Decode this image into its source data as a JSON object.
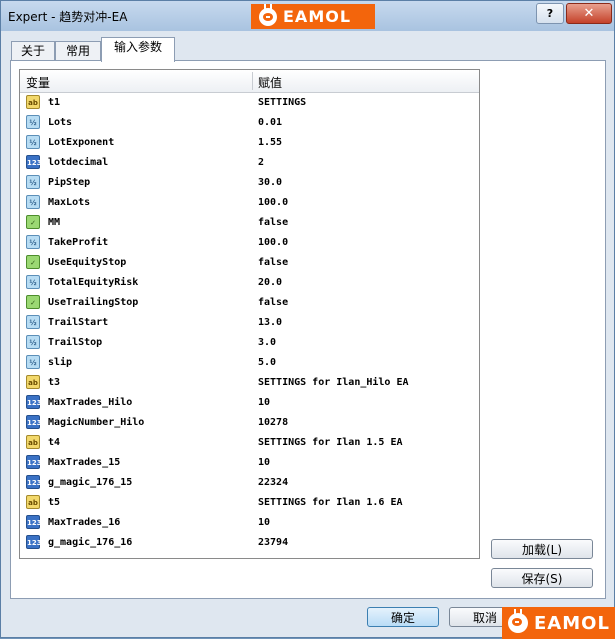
{
  "window": {
    "title": "Expert - 趋势对冲-EA",
    "help_label": "?",
    "close_label": "✕"
  },
  "logo": {
    "text": "EAMOL"
  },
  "tabs": [
    {
      "label": "关于"
    },
    {
      "label": "常用"
    },
    {
      "label": "输入参数"
    }
  ],
  "grid": {
    "headers": {
      "variable": "变量",
      "value": "赋值"
    },
    "rows": [
      {
        "type": "ab",
        "name": "t1",
        "value": "SETTINGS"
      },
      {
        "type": "v2",
        "name": "Lots",
        "value": "0.01"
      },
      {
        "type": "v2",
        "name": "LotExponent",
        "value": "1.55"
      },
      {
        "type": "i123",
        "name": "lotdecimal",
        "value": "2"
      },
      {
        "type": "v2",
        "name": "PipStep",
        "value": "30.0"
      },
      {
        "type": "v2",
        "name": "MaxLots",
        "value": "100.0"
      },
      {
        "type": "bool",
        "name": "MM",
        "value": "false"
      },
      {
        "type": "v2",
        "name": "TakeProfit",
        "value": "100.0"
      },
      {
        "type": "bool",
        "name": "UseEquityStop",
        "value": "false"
      },
      {
        "type": "v2",
        "name": "TotalEquityRisk",
        "value": "20.0"
      },
      {
        "type": "bool",
        "name": "UseTrailingStop",
        "value": "false"
      },
      {
        "type": "v2",
        "name": "TrailStart",
        "value": "13.0"
      },
      {
        "type": "v2",
        "name": "TrailStop",
        "value": "3.0"
      },
      {
        "type": "v2",
        "name": "slip",
        "value": "5.0"
      },
      {
        "type": "ab",
        "name": "t3",
        "value": "SETTINGS for Ilan_Hilo EA"
      },
      {
        "type": "i123",
        "name": "MaxTrades_Hilo",
        "value": "10"
      },
      {
        "type": "i123",
        "name": "MagicNumber_Hilo",
        "value": "10278"
      },
      {
        "type": "ab",
        "name": "t4",
        "value": "SETTINGS for Ilan 1.5 EA"
      },
      {
        "type": "i123",
        "name": "MaxTrades_15",
        "value": "10"
      },
      {
        "type": "i123",
        "name": "g_magic_176_15",
        "value": "22324"
      },
      {
        "type": "ab",
        "name": "t5",
        "value": "SETTINGS for Ilan 1.6 EA"
      },
      {
        "type": "i123",
        "name": "MaxTrades_16",
        "value": "10"
      },
      {
        "type": "i123",
        "name": "g_magic_176_16",
        "value": "23794"
      }
    ]
  },
  "icons": {
    "ab": "ab",
    "v2": "½",
    "i123": "123",
    "bool": "✓"
  },
  "buttons": {
    "load": "加载(L)",
    "save": "保存(S)",
    "ok": "确定",
    "cancel": "取消"
  }
}
